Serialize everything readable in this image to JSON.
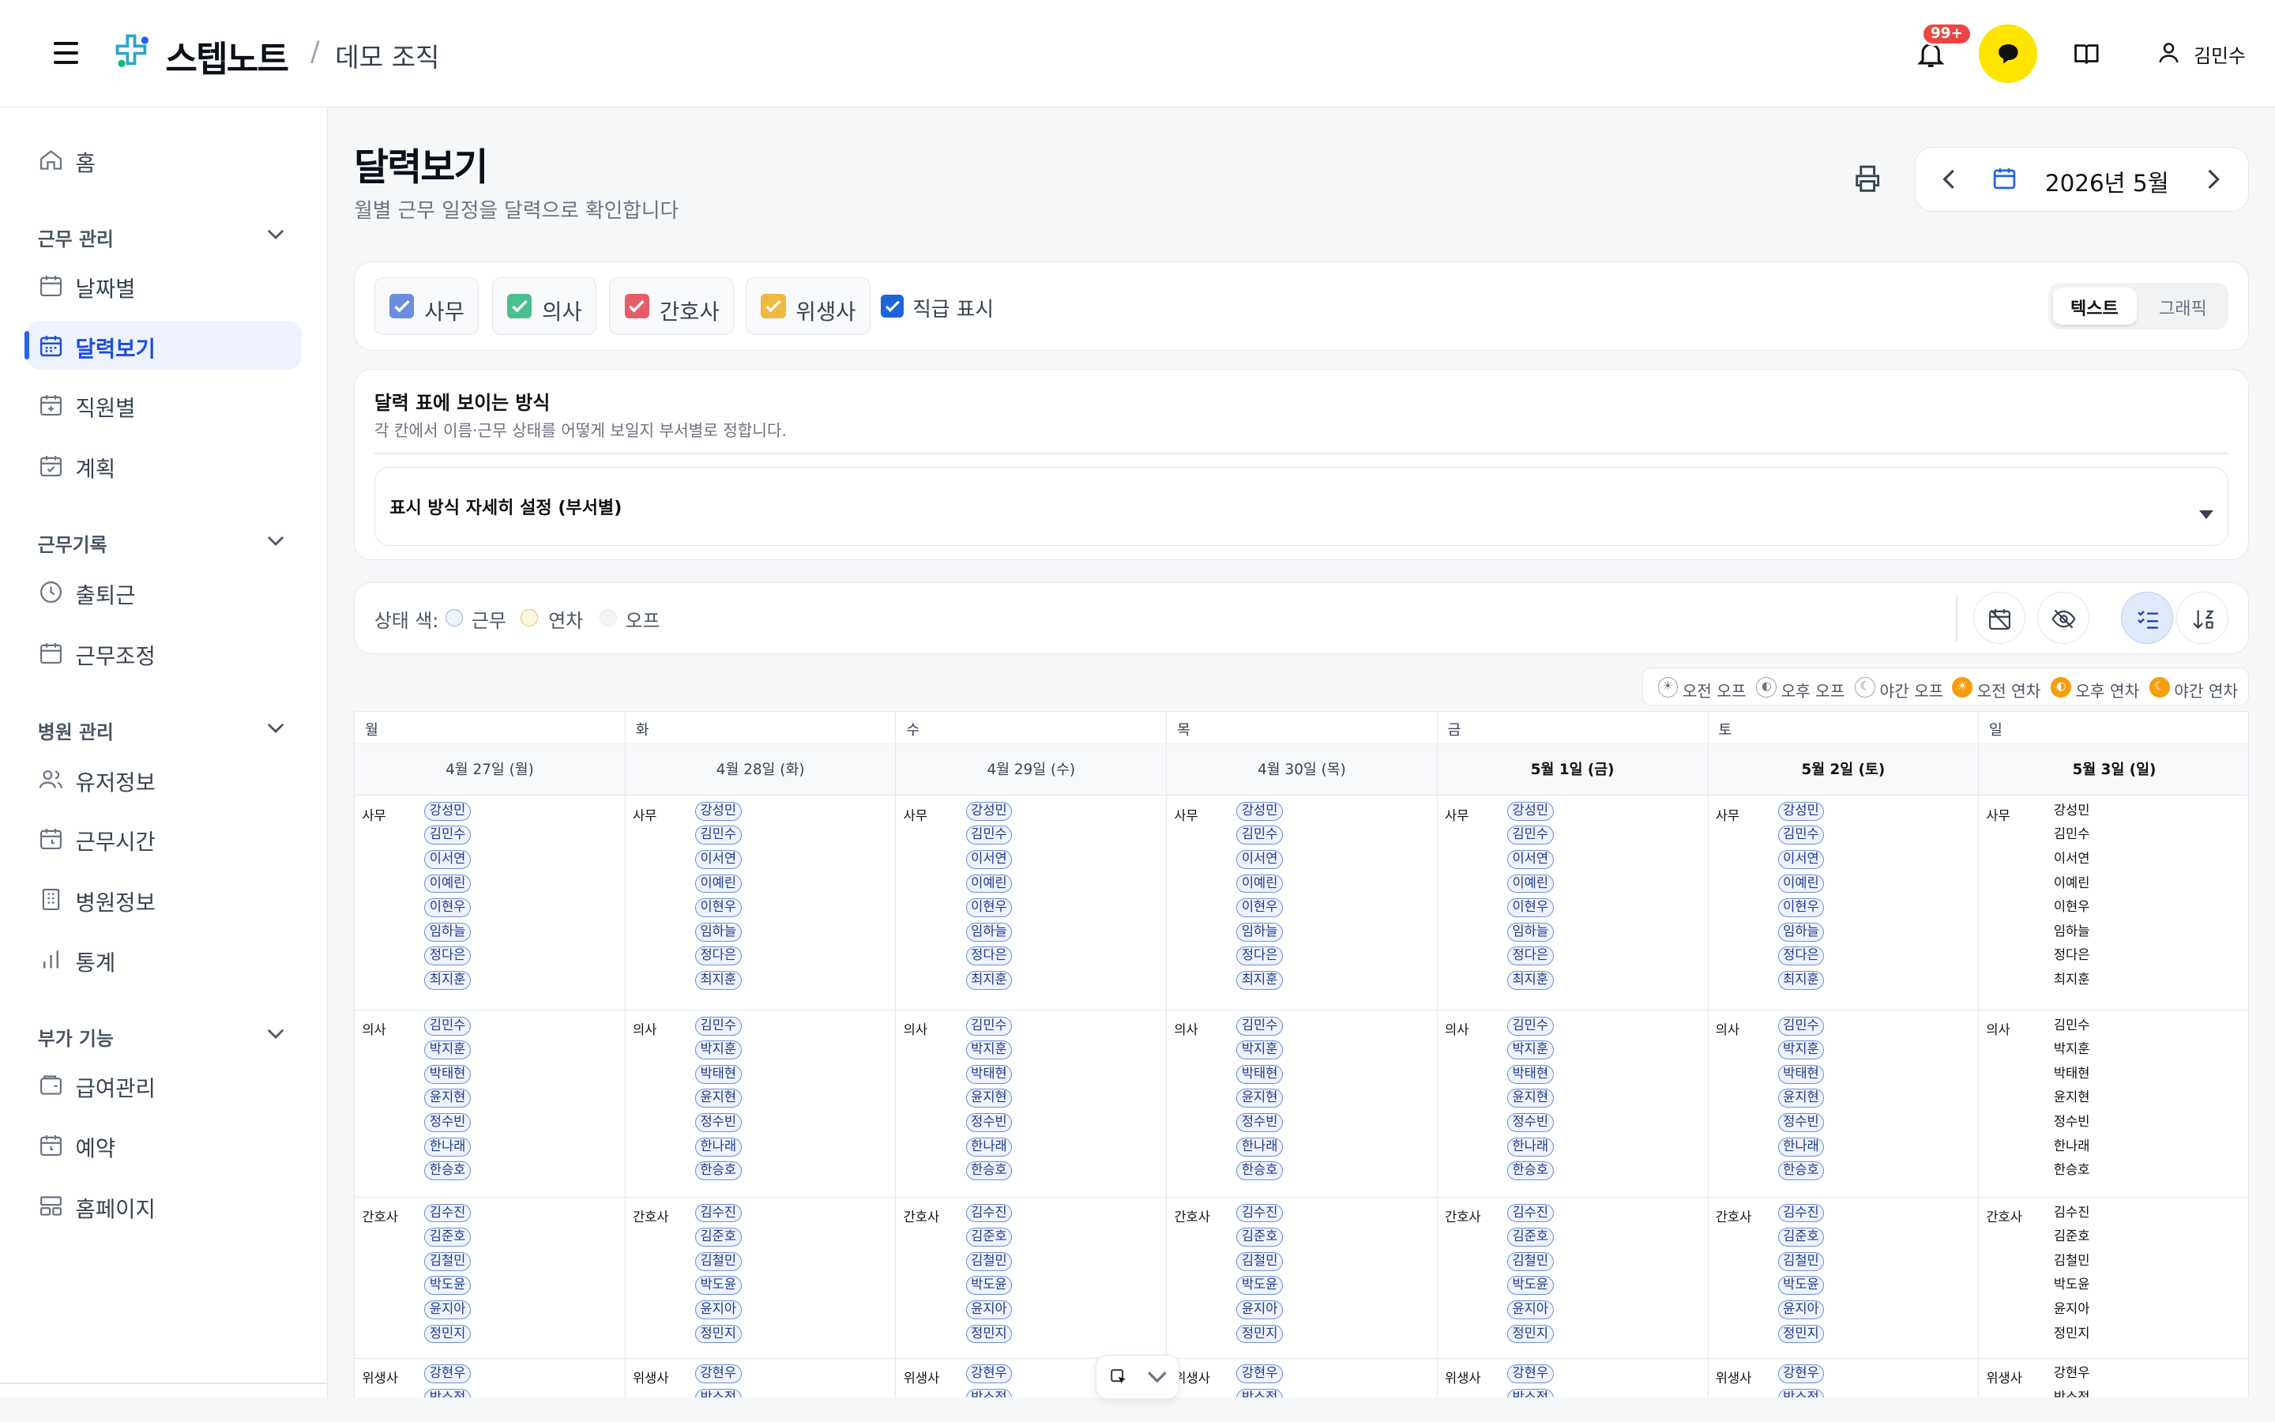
{
  "header": {
    "brand": "스텝노트",
    "org": "데모 조직",
    "notif_badge": "99+",
    "user_name": "김민수"
  },
  "sidebar": {
    "home": "홈",
    "sections": [
      {
        "title": "근무 관리",
        "items": [
          "날짜별",
          "달력보기",
          "직원별",
          "계획"
        ]
      },
      {
        "title": "근무기록",
        "items": [
          "출퇴근",
          "근무조정"
        ]
      },
      {
        "title": "병원 관리",
        "items": [
          "유저정보",
          "근무시간",
          "병원정보",
          "통계"
        ]
      },
      {
        "title": "부가 기능",
        "items": [
          "급여관리",
          "예약",
          "홈페이지"
        ]
      }
    ],
    "active_item": "달력보기"
  },
  "page": {
    "title": "달력보기",
    "subtitle": "월별 근무 일정을 달력으로 확인합니다",
    "month_label": "2026년 5월"
  },
  "filters": {
    "chips": [
      {
        "label": "사무",
        "checked": true,
        "color": "#6a8ddd"
      },
      {
        "label": "의사",
        "checked": true,
        "color": "#4cbf8f"
      },
      {
        "label": "간호사",
        "checked": true,
        "color": "#e35d6a"
      },
      {
        "label": "위생사",
        "checked": true,
        "color": "#efb840"
      }
    ],
    "show_position_label": "직급 표시",
    "view_text": "텍스트",
    "view_graphic": "그래픽"
  },
  "display": {
    "title": "달력 표에 보이는 방식",
    "subtitle": "각 칸에서 이름·근무 상태를 어떻게 보일지 부서별로 정합니다.",
    "accordion_label": "표시 방식 자세히 설정 (부서별)"
  },
  "status": {
    "label": "상태 색:",
    "work": "근무",
    "leave": "연차",
    "off": "오프"
  },
  "legend": [
    "오전 오프",
    "오후 오프",
    "야간 오프",
    "오전 연차",
    "오후 연차",
    "야간 연차"
  ],
  "calendar": {
    "days": [
      {
        "dow": "월",
        "date": "4월 27일 (월)"
      },
      {
        "dow": "화",
        "date": "4월 28일 (화)"
      },
      {
        "dow": "수",
        "date": "4월 29일 (수)"
      },
      {
        "dow": "목",
        "date": "4월 30일 (목)"
      },
      {
        "dow": "금",
        "date": "5월 1일 (금)"
      },
      {
        "dow": "토",
        "date": "5월 2일 (토)"
      },
      {
        "dow": "일",
        "date": "5월 3일 (일)"
      }
    ],
    "groups": [
      {
        "label": "사무",
        "names": [
          "강성민",
          "김민수",
          "이서연",
          "이예린",
          "이현우",
          "임하늘",
          "정다은",
          "최지훈"
        ]
      },
      {
        "label": "의사",
        "names": [
          "김민수",
          "박지훈",
          "박태현",
          "윤지현",
          "정수빈",
          "한나래",
          "한승호"
        ]
      },
      {
        "label": "간호사",
        "names": [
          "김수진",
          "김준호",
          "김철민",
          "박도윤",
          "윤지아",
          "정민지"
        ]
      },
      {
        "label": "위생사",
        "names": [
          "강현우",
          "박소정"
        ]
      }
    ]
  }
}
